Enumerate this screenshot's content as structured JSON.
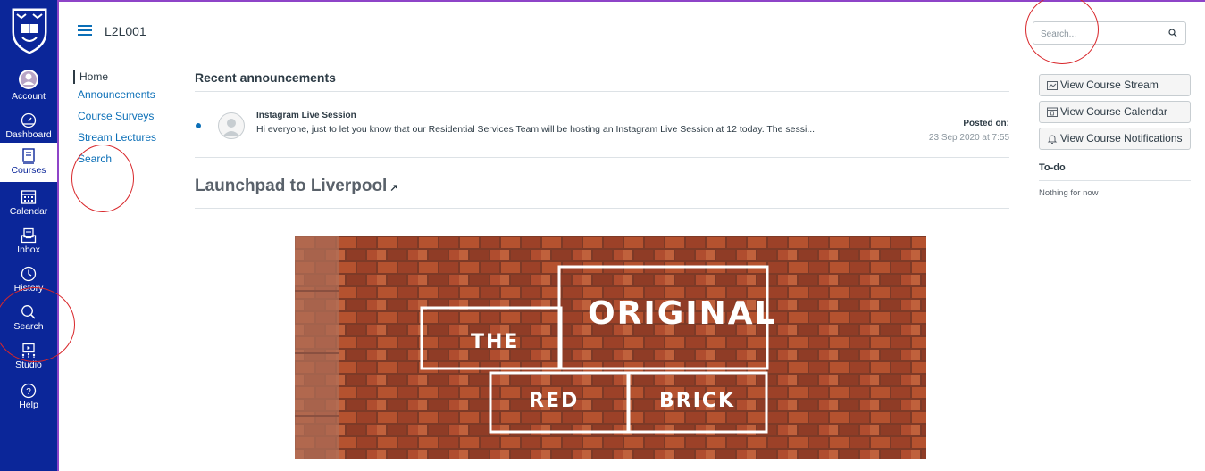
{
  "global_nav": {
    "items": [
      {
        "label": "Account",
        "icon": "account-icon"
      },
      {
        "label": "Dashboard",
        "icon": "dashboard-icon"
      },
      {
        "label": "Courses",
        "icon": "courses-icon",
        "active": true
      },
      {
        "label": "Calendar",
        "icon": "calendar-icon"
      },
      {
        "label": "Inbox",
        "icon": "inbox-icon"
      },
      {
        "label": "History",
        "icon": "history-icon"
      },
      {
        "label": "Search",
        "icon": "search-icon"
      },
      {
        "label": "Studio",
        "icon": "studio-icon"
      },
      {
        "label": "Help",
        "icon": "help-icon"
      }
    ],
    "bg_color": "#0b2699"
  },
  "header": {
    "course_code": "L2L001",
    "search_placeholder": "Search..."
  },
  "course_nav": {
    "items": [
      {
        "label": "Home",
        "active": true
      },
      {
        "label": "Announcements"
      },
      {
        "label": "Course Surveys"
      },
      {
        "label": "Stream Lectures"
      },
      {
        "label": "Search"
      }
    ]
  },
  "main": {
    "recent_heading": "Recent announcements",
    "announcement": {
      "title": "Instagram Live Session",
      "message": "Hi everyone, just to let you know that our Residential Services Team will be hosting an Instagram Live Session at 12 today. The sessi...",
      "posted_label": "Posted on:",
      "posted_date": "23 Sep 2020 at 7:55"
    },
    "page_heading": "Launchpad to Liverpool",
    "banner_words": [
      "THE",
      "ORIGINAL",
      "RED",
      "BRICK"
    ]
  },
  "sidebar": {
    "buttons": [
      {
        "label": "View Course Stream",
        "icon": "stream-icon"
      },
      {
        "label": "View Course Calendar",
        "icon": "calendar-icon"
      },
      {
        "label": "View Course Notifications",
        "icon": "bell-icon"
      }
    ],
    "todo_heading": "To-do",
    "todo_empty": "Nothing for now"
  },
  "colors": {
    "link": "#0b6fb7",
    "annotation_circle": "#d8262a"
  }
}
